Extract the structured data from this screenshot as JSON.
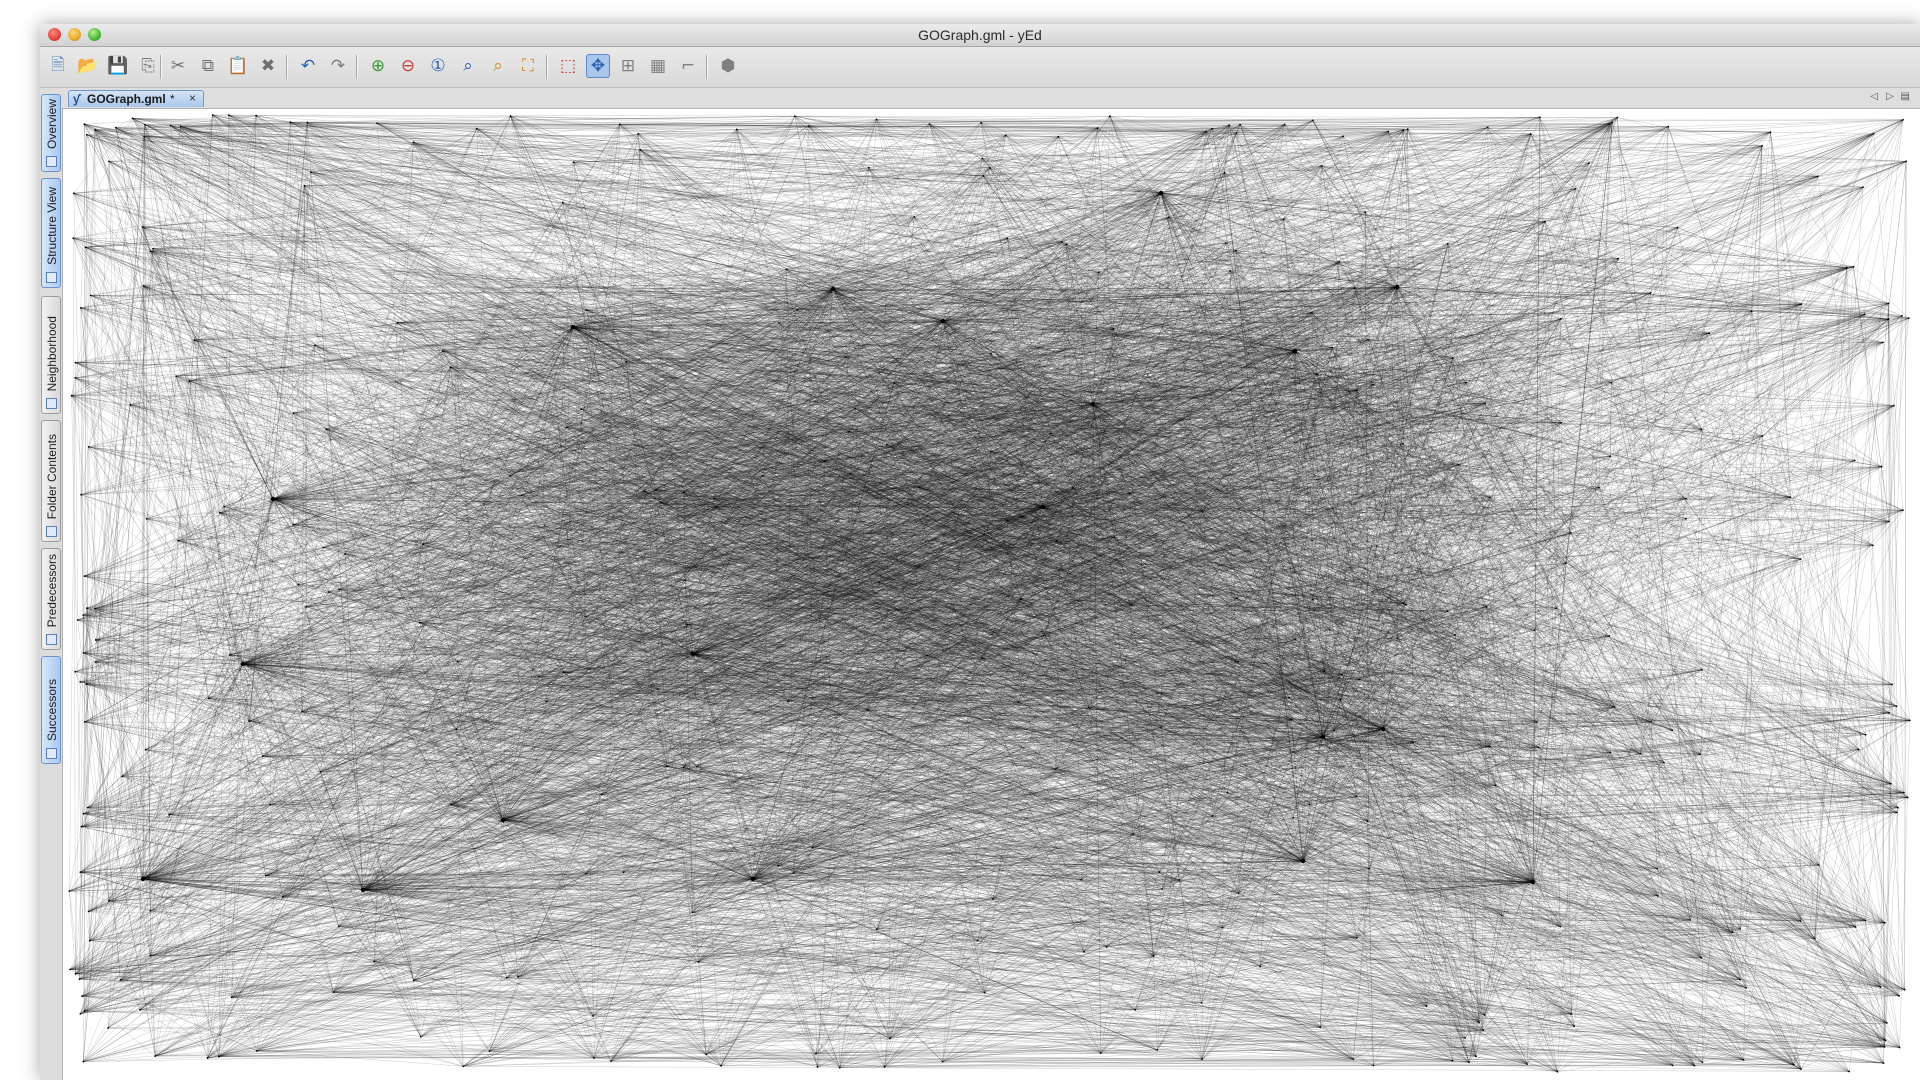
{
  "window": {
    "title": "GOGraph.gml - yEd"
  },
  "toolbar": {
    "buttons": [
      {
        "name": "new-document-icon",
        "color": "#5a86c4"
      },
      {
        "name": "open-folder-icon",
        "color": "#d9a520"
      },
      {
        "name": "save-icon",
        "color": "#2a5ea8"
      },
      {
        "name": "export-icon",
        "color": "#7a7a7a"
      },
      {
        "name": "cut-icon",
        "color": "#707070"
      },
      {
        "name": "copy-icon",
        "color": "#707070"
      },
      {
        "name": "paste-icon",
        "color": "#707070"
      },
      {
        "name": "delete-icon",
        "color": "#707070"
      },
      {
        "name": "undo-icon",
        "color": "#2d62b0"
      },
      {
        "name": "redo-icon",
        "color": "#7a7a7a"
      },
      {
        "name": "zoom-in-icon",
        "color": "#3a9a3a"
      },
      {
        "name": "zoom-out-icon",
        "color": "#c43a3a"
      },
      {
        "name": "zoom-original-icon",
        "color": "#2d62b0"
      },
      {
        "name": "zoom-area-icon",
        "color": "#2d62b0"
      },
      {
        "name": "zoom-selection-icon",
        "color": "#d08a20"
      },
      {
        "name": "fit-content-icon",
        "color": "#d08a20"
      },
      {
        "name": "edit-mode-icon",
        "color": "#c03030"
      },
      {
        "name": "navigation-mode-icon",
        "color": "#2d62b0"
      },
      {
        "name": "grouping-icon",
        "color": "#808080"
      },
      {
        "name": "grid-icon",
        "color": "#808080"
      },
      {
        "name": "snap-icon",
        "color": "#808080"
      },
      {
        "name": "plugin-icon",
        "color": "#808080"
      }
    ]
  },
  "side_tabs": [
    {
      "label": "Overview",
      "selected": true
    },
    {
      "label": "Structure View",
      "selected": true
    },
    {
      "label": "Neighborhood",
      "selected": false
    },
    {
      "label": "Folder Contents",
      "selected": false
    },
    {
      "label": "Predecessors",
      "selected": false
    },
    {
      "label": "Successors",
      "selected": true
    }
  ],
  "document_tab": {
    "label": "GOGraph.gml",
    "modified_marker": "*",
    "close_glyph": "×"
  },
  "tab_nav": {
    "left": "◁",
    "right": "▷",
    "list": "▤"
  },
  "graph": {
    "edge_color": "#000000",
    "node_color": "#000000",
    "background": "#ffffff"
  }
}
